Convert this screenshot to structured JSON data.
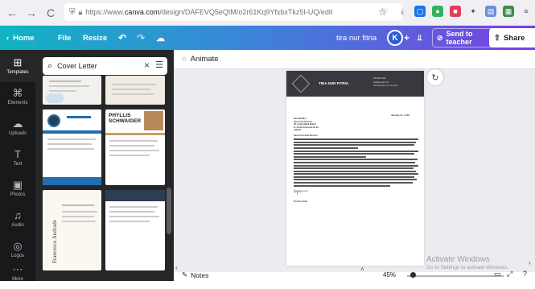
{
  "browser": {
    "url_prefix": "https://www.",
    "url_host": "canva.com",
    "url_path": "/design/DAFEVQ5eQtM/o2r61Kq9YfxbxTkz5I-UQ/edit"
  },
  "topbar": {
    "home_label": "Home",
    "file_label": "File",
    "resize_label": "Resize",
    "user_name": "tira nur fitria",
    "avatar_initial": "K",
    "send_label": "Send to teacher",
    "share_label": "Share"
  },
  "leftnav": {
    "items": [
      {
        "label": "Templates",
        "icon": "templates-icon"
      },
      {
        "label": "Elements",
        "icon": "elements-icon"
      },
      {
        "label": "Uploads",
        "icon": "uploads-icon"
      },
      {
        "label": "Text",
        "icon": "text-icon"
      },
      {
        "label": "Photos",
        "icon": "photos-icon"
      },
      {
        "label": "Audio",
        "icon": "audio-icon"
      },
      {
        "label": "Logos",
        "icon": "logos-icon"
      },
      {
        "label": "More",
        "icon": "more-icon"
      }
    ]
  },
  "panel": {
    "search_value": "Cover Letter",
    "thumb_phyllis": "PHYLLIS SCHWAIGER",
    "thumb_side_name": "Francesco Andrade"
  },
  "editor": {
    "animate_label": "Animate",
    "doc_header_name": "TIRA NUR FITRIA",
    "doc_contact": [
      "000-000-0000",
      "hello@email.com",
      "123 Anywhere St., Any City"
    ],
    "doc_date": "January 01, 2 097",
    "doc_recipient": [
      "Dear Mr./Mrs.",
      "Personnel Director",
      "PT. Angin Mukti Mulati",
      "Jl. Cinta Indonesia No.23",
      "Jakarta"
    ],
    "doc_salutation": "Dear Personnel Director.",
    "doc_closing": "Sincerely yours,",
    "doc_signature_name": "Tira Nur Fitria"
  },
  "bottombar": {
    "notes_label": "Notes",
    "zoom": "45%"
  },
  "watermark": {
    "line1": "Activate Windows",
    "line2": "Go to Settings to activate Windows."
  },
  "colors": {
    "canva_gradient_start": "#11b4c3",
    "canva_gradient_end": "#7a3fe0",
    "sidebar_bg": "#18191b",
    "panel_bg": "#252627",
    "doc_header": "#38393e"
  }
}
